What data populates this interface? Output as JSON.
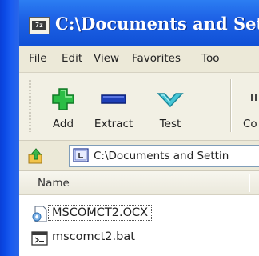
{
  "window": {
    "title": "C:\\Documents and Settin",
    "icon": "archive-app-icon",
    "icon_text": "7z"
  },
  "menu": {
    "items": [
      "File",
      "Edit",
      "View",
      "Favorites",
      "Too"
    ]
  },
  "toolbar": {
    "buttons": [
      {
        "label": "Add",
        "icon": "add-plus-icon",
        "color": "#22b14c"
      },
      {
        "label": "Extract",
        "icon": "extract-minus-icon",
        "color": "#1a3bb0"
      },
      {
        "label": "Test",
        "icon": "test-check-icon",
        "color": "#3fbfcf"
      },
      {
        "label": "Co",
        "icon": "copy-icon",
        "color": "#333333"
      }
    ]
  },
  "address": {
    "value": "C:\\Documents and Settin",
    "up_icon": "up-folder-icon"
  },
  "list": {
    "columns": [
      "Name"
    ],
    "files": [
      {
        "name": "MSCOMCT2.OCX",
        "icon": "ocx-file-icon",
        "focused": true
      },
      {
        "name": "mscomct2.bat",
        "icon": "bat-file-icon",
        "focused": false
      }
    ]
  },
  "colors": {
    "titlebar": "#1e62e6",
    "menubar": "#ece9d8"
  }
}
